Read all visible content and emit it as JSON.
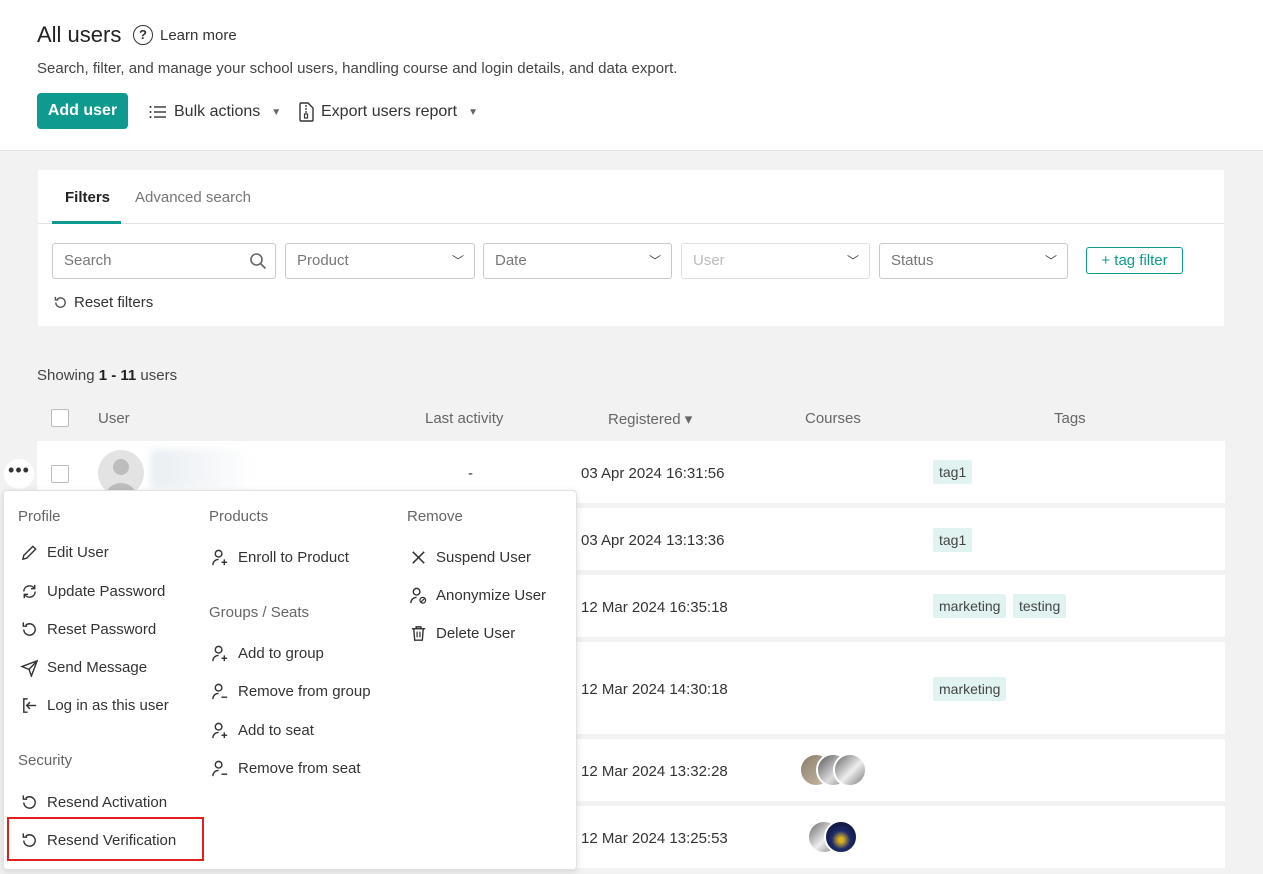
{
  "header": {
    "title": "All users",
    "learn_more": "Learn more",
    "subtitle": "Search, filter, and manage your school users, handling course and login details, and data export.",
    "add_user": "Add user",
    "bulk_actions": "Bulk actions",
    "export_report": "Export users report"
  },
  "filters": {
    "tabs": [
      "Filters",
      "Advanced search"
    ],
    "search_placeholder": "Search",
    "product": "Product",
    "date": "Date",
    "user": "User",
    "status": "Status",
    "tag_filter": "+ tag filter",
    "reset": "Reset filters"
  },
  "table": {
    "showing_prefix": "Showing ",
    "showing_range": "1 - 11",
    "showing_suffix": " users",
    "columns": {
      "user": "User",
      "last_activity": "Last activity",
      "registered": "Registered ▾",
      "courses": "Courses",
      "tags": "Tags"
    },
    "rows": [
      {
        "last_activity": "-",
        "registered": "03 Apr 2024 16:31:56",
        "tags": [
          "tag1"
        ]
      },
      {
        "registered": "03 Apr 2024 13:13:36",
        "tags": [
          "tag1"
        ]
      },
      {
        "registered": "12 Mar 2024 16:35:18",
        "tags": [
          "marketing",
          "testing"
        ]
      },
      {
        "registered": "12 Mar 2024 14:30:18",
        "tags": [
          "marketing"
        ]
      },
      {
        "registered": "12 Mar 2024 13:32:28",
        "tags": []
      },
      {
        "registered": "12 Mar 2024 13:25:53",
        "tags": []
      }
    ]
  },
  "menu": {
    "profile_head": "Profile",
    "edit_user": "Edit User",
    "update_password": "Update Password",
    "reset_password": "Reset Password",
    "send_message": "Send Message",
    "login_as": "Log in as this user",
    "security_head": "Security",
    "resend_activation": "Resend Activation",
    "resend_verification": "Resend Verification",
    "products_head": "Products",
    "enroll": "Enroll to Product",
    "groups_head": "Groups / Seats",
    "add_group": "Add to group",
    "remove_group": "Remove from group",
    "add_seat": "Add to seat",
    "remove_seat": "Remove from seat",
    "remove_head": "Remove",
    "suspend": "Suspend User",
    "anonymize": "Anonymize User",
    "delete": "Delete User"
  },
  "colors": {
    "accent": "#0e9a8e",
    "tag_bg": "#e1f3f1",
    "highlight": "#e02020"
  }
}
